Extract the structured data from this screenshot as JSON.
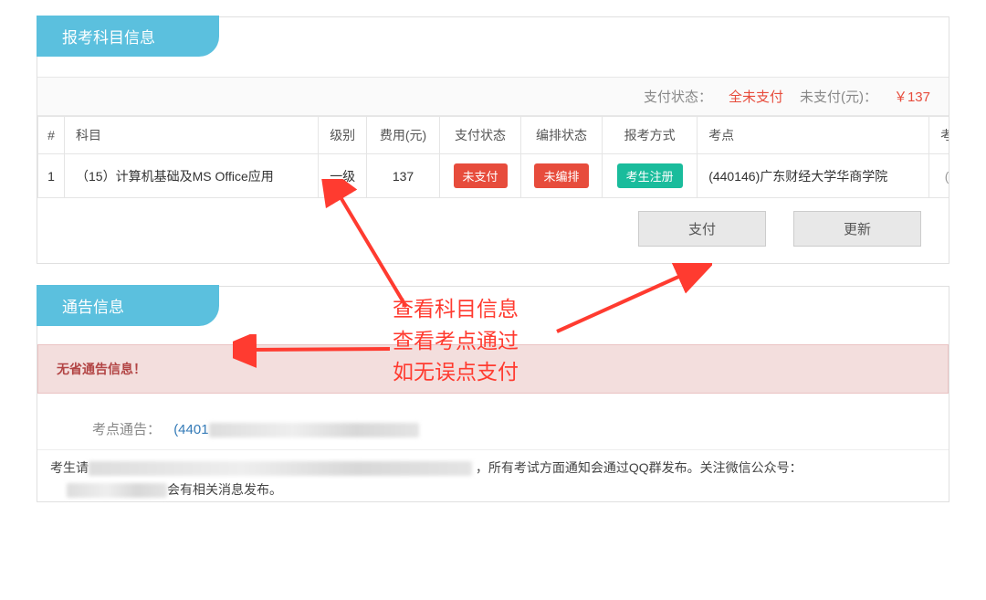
{
  "panel1": {
    "title": "报考科目信息",
    "pay_status_label": "支付状态：",
    "pay_status_value": "全未支付",
    "unpaid_label": "未支付(元)：",
    "unpaid_value": "￥137",
    "cols": {
      "idx": "#",
      "subject": "科目",
      "level": "级别",
      "fee": "费用(元)",
      "pay": "支付状态",
      "arrange": "编排状态",
      "method": "报考方式",
      "site": "考点",
      "extra": "考场"
    },
    "row": {
      "idx": "1",
      "subject": "（15）计算机基础及MS Office应用",
      "level": "一级",
      "fee": "137",
      "pay": "未支付",
      "arrange": "未编排",
      "method": "考生注册",
      "site": "(440146)广东财经大学华商学院",
      "extra": "(准"
    },
    "buttons": {
      "pay": "支付",
      "refresh": "更新"
    }
  },
  "annotation": {
    "line1": "查看科目信息",
    "line2": "查看考点通过",
    "line3": "如无误点支付"
  },
  "panel2": {
    "title": "通告信息",
    "alert": "无省通告信息！",
    "notice_label": "考点通告：",
    "notice_prefix": "(4401",
    "body_p1_prefix": "考生请",
    "body_p1_mid": "   ，所有考试方面通知会通过QQ群发布。关注微信公众号：",
    "body_p2_suffix": "会有相关消息发布。"
  }
}
